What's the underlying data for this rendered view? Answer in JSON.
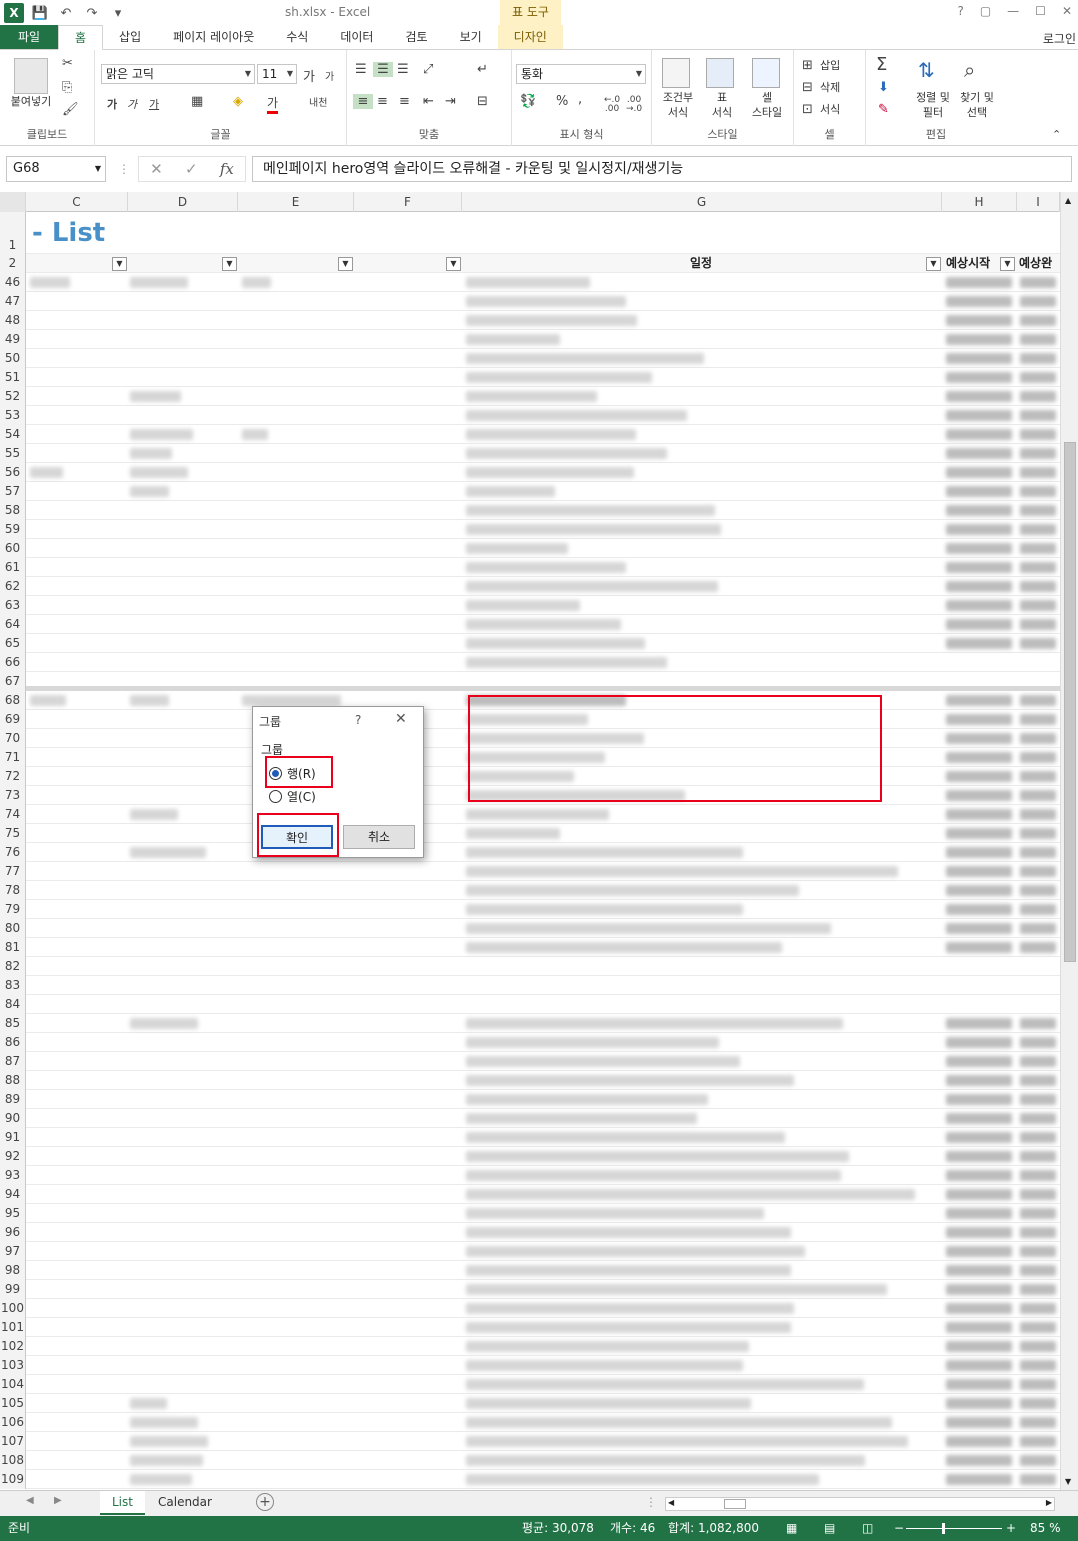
{
  "window": {
    "title": "sh.xlsx - Excel",
    "table_tools": "표 도구",
    "ctrl_help": "?",
    "ctrl_restore": "▢",
    "ctrl_min": "—",
    "ctrl_max": "☐",
    "ctrl_close": "✕",
    "login": "로그인"
  },
  "ribbon_tabs": [
    "파일",
    "홈",
    "삽입",
    "페이지 레이아웃",
    "수식",
    "데이터",
    "검토",
    "보기",
    "디자인"
  ],
  "ribbon": {
    "clipboard": {
      "paste": "붙여넣기",
      "label": "클립보드"
    },
    "font": {
      "name": "맑은 고딕",
      "size": "11",
      "grow": "가",
      "shrink": "가",
      "bold": "가",
      "italic": "가",
      "underline": "가",
      "color_char": "가",
      "phonetic": "내천",
      "label": "글꼴"
    },
    "align": {
      "label": "맞춤"
    },
    "number": {
      "format": "통화",
      "percent": "%",
      "comma": ",",
      "inc": "←.0\n.00",
      "dec": ".00\n→.0",
      "label": "표시 형식"
    },
    "styles": {
      "cond": "조건부\n서식",
      "table": "표\n서식",
      "cell": "셀\n스타일",
      "label": "스타일"
    },
    "cells": {
      "insert": "삽입",
      "delete": "삭제",
      "format": "서식",
      "label": "셀"
    },
    "edit": {
      "sum": "Σ",
      "sort": "정렬 및\n필터",
      "find": "찾기 및\n선택",
      "label": "편집"
    }
  },
  "formula_bar": {
    "name_box": "G68",
    "formula": "메인페이지 hero영역 슬라이드 오류해결 - 카운팅 및 일시정지/재생기능"
  },
  "columns": [
    "C",
    "D",
    "E",
    "F",
    "G",
    "H",
    "I"
  ],
  "sheet": {
    "title": "- List",
    "header_g": "일정",
    "header_h": "예상시작",
    "header_i": "예상완",
    "rows": [
      "1",
      "2",
      "46",
      "47",
      "48",
      "49",
      "50",
      "51",
      "52",
      "53",
      "54",
      "55",
      "56",
      "57",
      "58",
      "59",
      "60",
      "61",
      "62",
      "63",
      "64",
      "65",
      "66",
      "67",
      "68",
      "69",
      "70",
      "71",
      "72",
      "73",
      "74",
      "75",
      "76",
      "77",
      "78",
      "79",
      "80",
      "81",
      "82",
      "83",
      "84",
      "85",
      "86",
      "87",
      "88",
      "89",
      "90",
      "91",
      "92",
      "93",
      "94",
      "95",
      "96",
      "97",
      "98",
      "99",
      "100",
      "101",
      "102",
      "103",
      "104",
      "105",
      "106",
      "107",
      "108",
      "109"
    ]
  },
  "dialog": {
    "title": "그룹",
    "help": "?",
    "group_label": "그룹",
    "rows_option": "행(R)",
    "cols_option": "열(C)",
    "ok": "확인",
    "cancel": "취소"
  },
  "sheet_tabs": [
    "List",
    "Calendar"
  ],
  "status": {
    "ready": "준비",
    "avg": "평균: 30,078",
    "count": "개수: 46",
    "sum": "합계: 1,082,800",
    "zoom": "85 %"
  },
  "colors": {
    "excel_green": "#217346",
    "highlight_red": "#e8001c",
    "title_blue": "#4a90c8",
    "table_tools_bg": "#fdf1c5"
  }
}
